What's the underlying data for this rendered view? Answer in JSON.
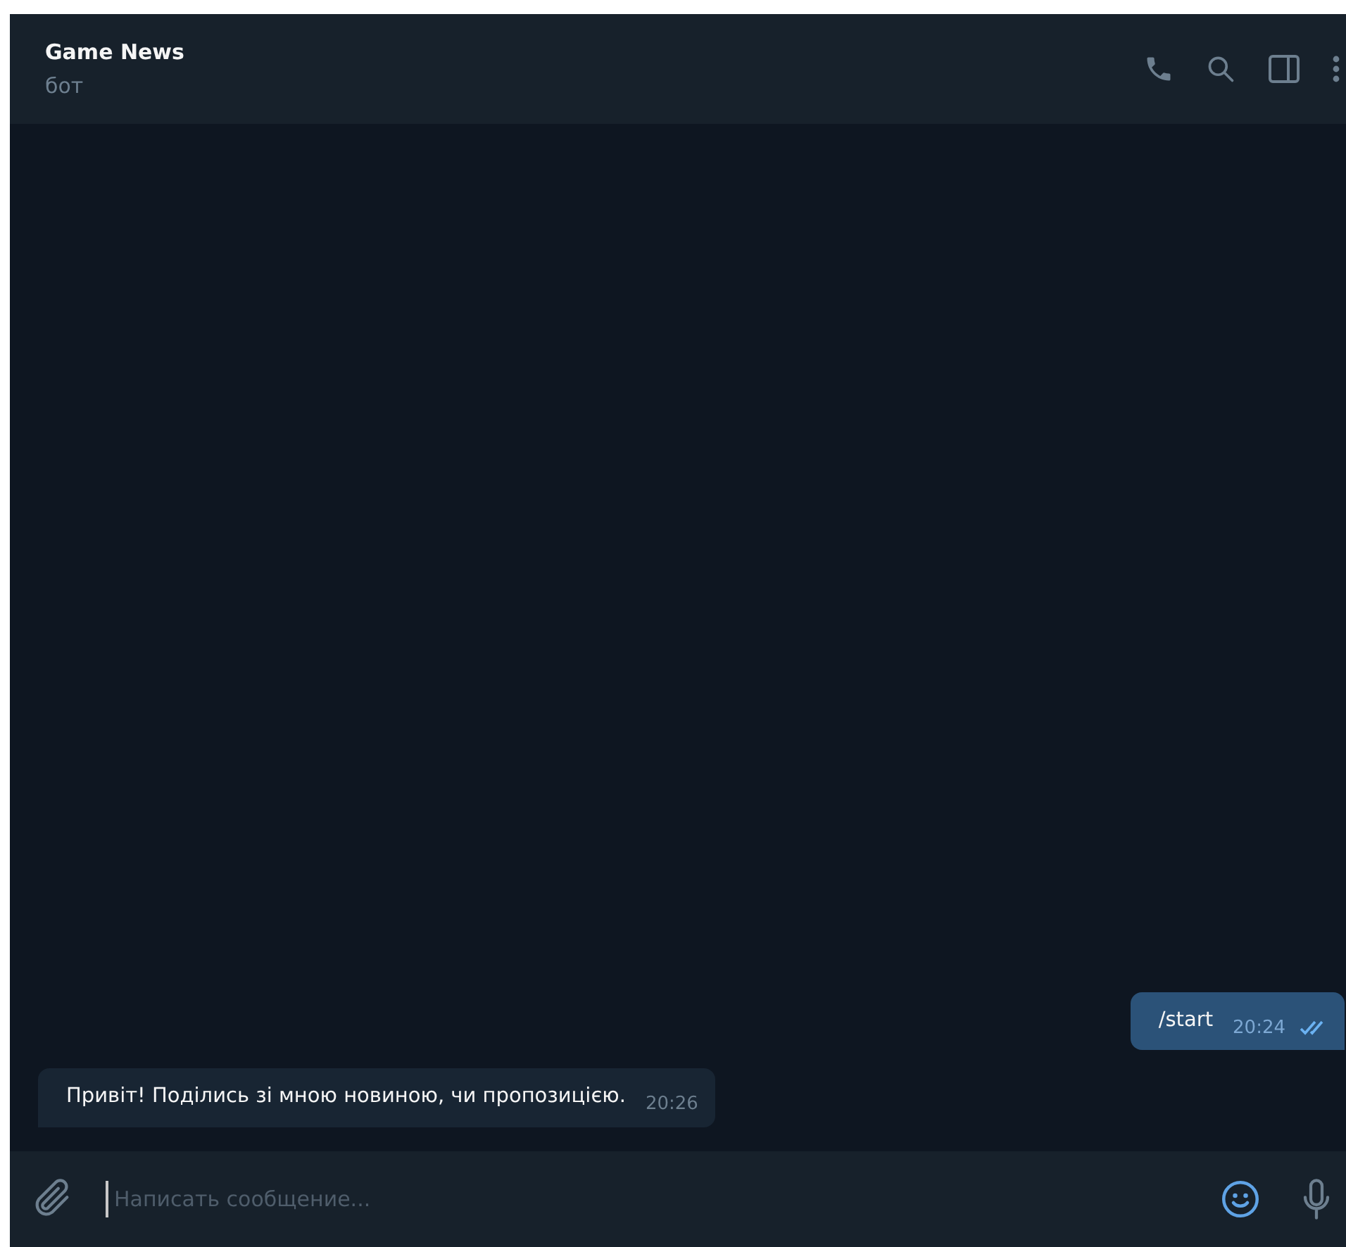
{
  "header": {
    "title": "Game News",
    "subtitle": "бот"
  },
  "messages": [
    {
      "kind": "outgoing",
      "text": "/start",
      "time": "20:24",
      "read": true
    },
    {
      "kind": "incoming",
      "text": "Привіт! Поділись зі мною новиною, чи пропозицією.",
      "time": "20:26"
    }
  ],
  "composer": {
    "placeholder": "Написать сообщение...",
    "emoji_active": true
  }
}
